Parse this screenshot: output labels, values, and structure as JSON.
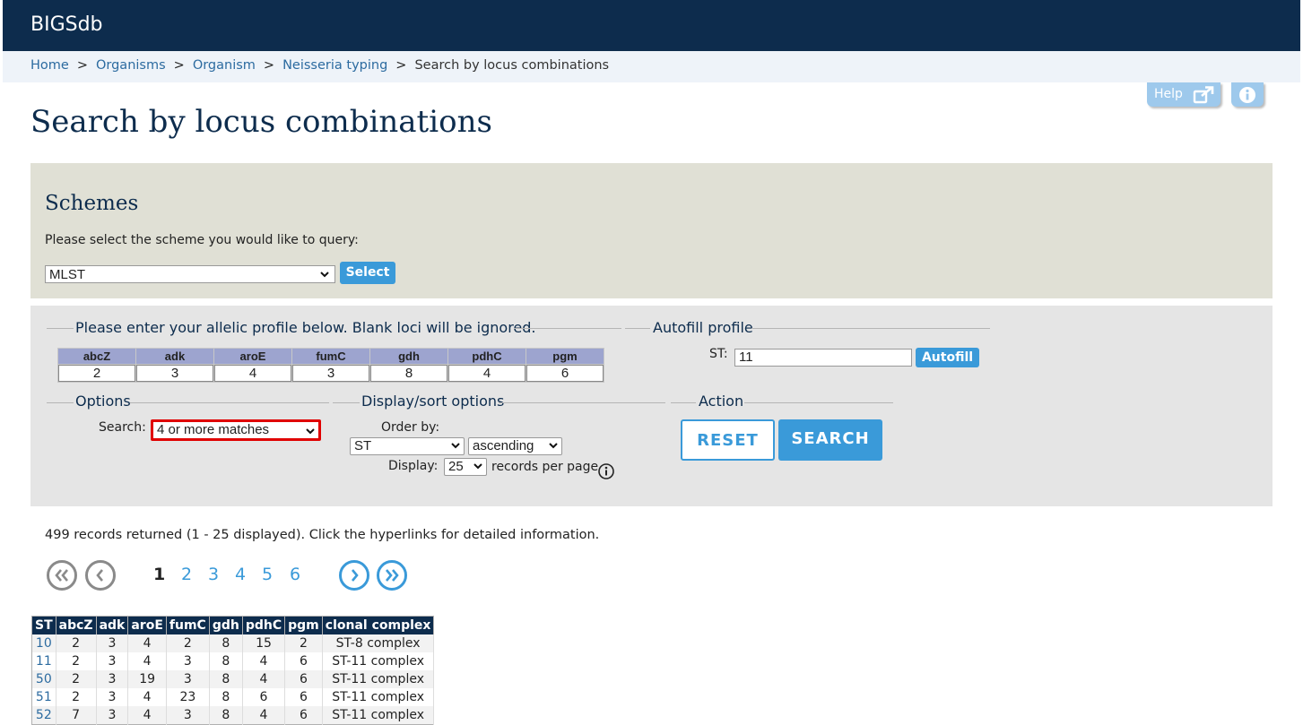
{
  "header": {
    "brand": "BIGSdb"
  },
  "breadcrumb": {
    "items": [
      "Home",
      "Organisms",
      "Organism",
      "Neisseria typing"
    ],
    "separator": ">",
    "current": "Search by locus combinations"
  },
  "top_buttons": {
    "help_label": "Help",
    "help_icon": "external-link-icon",
    "info_icon": "info-icon"
  },
  "page": {
    "title": "Search by locus combinations"
  },
  "schemes": {
    "heading": "Schemes",
    "instruction": "Please select the scheme you would like to query:",
    "selected": "MLST",
    "select_button": "Select"
  },
  "profile": {
    "legend": "Please enter your allelic profile below. Blank loci will be ignored.",
    "loci": [
      "abcZ",
      "adk",
      "aroE",
      "fumC",
      "gdh",
      "pdhC",
      "pgm"
    ],
    "values": [
      "2",
      "3",
      "4",
      "3",
      "8",
      "4",
      "6"
    ]
  },
  "autofill": {
    "legend": "Autofill profile",
    "st_label": "ST:",
    "st_value": "11",
    "button": "Autofill"
  },
  "options": {
    "legend": "Options",
    "search_label": "Search:",
    "search_value": "4 or more matches"
  },
  "display_sort": {
    "legend": "Display/sort options",
    "order_label": "Order by:",
    "order_field": "ST",
    "order_direction": "ascending",
    "display_label": "Display:",
    "display_value": "25",
    "per_page_label": "records per page"
  },
  "action": {
    "legend": "Action",
    "reset": "RESET",
    "search": "SEARCH"
  },
  "results": {
    "summary": "499 records returned (1 - 25 displayed). Click the hyperlinks for detailed information.",
    "pages": [
      "1",
      "2",
      "3",
      "4",
      "5",
      "6"
    ],
    "current_page": "1",
    "columns": [
      "ST",
      "abcZ",
      "adk",
      "aroE",
      "fumC",
      "gdh",
      "pdhC",
      "pgm",
      "clonal complex"
    ],
    "rows": [
      [
        "10",
        "2",
        "3",
        "4",
        "2",
        "8",
        "15",
        "2",
        "ST-8 complex"
      ],
      [
        "11",
        "2",
        "3",
        "4",
        "3",
        "8",
        "4",
        "6",
        "ST-11 complex"
      ],
      [
        "50",
        "2",
        "3",
        "19",
        "3",
        "8",
        "4",
        "6",
        "ST-11 complex"
      ],
      [
        "51",
        "2",
        "3",
        "4",
        "23",
        "8",
        "6",
        "6",
        "ST-11 complex"
      ],
      [
        "52",
        "7",
        "3",
        "4",
        "3",
        "8",
        "4",
        "6",
        "ST-11 complex"
      ]
    ]
  },
  "colors": {
    "header_bg": "#0d2c4d",
    "accent": "#3a9ad9",
    "highlight_border": "#e00000"
  }
}
